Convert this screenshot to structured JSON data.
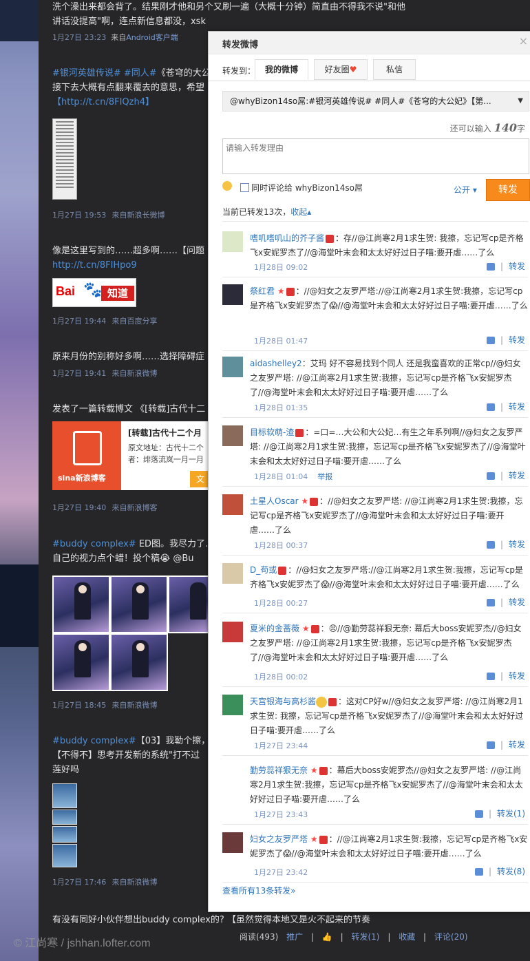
{
  "feed": {
    "post1_line1": "洗个澡出来都会背了。结果刚才他和另个又刷一遍（大概十分钟）简直由不得我不说\"和他",
    "post1_line2": "讲话没提高\"啊，连点新信息都没，xsk",
    "post1_time": "1月27日 23:23",
    "post1_from": "来自",
    "post1_src": "Android客户端",
    "post2_tag": "#银河英雄传说# #同人#",
    "post2_text": "《苍穹的大公",
    "post2_line2": "接下去大概有点翻来覆去的意思，希望",
    "post2_link": "【http://t.cn/8FIQzh4】",
    "post2_time": "1月27日 19:53",
    "post2_from": "来自",
    "post2_src": "新浪长微博",
    "post3_text": "像是这里写到的……超多啊……【问题",
    "post3_link": "http://t.cn/8FIHpo9",
    "post3_baidu_logo": "Bai",
    "post3_baidu_zd": "知道",
    "post3_time": "1月27日 19:44",
    "post3_from": "来自",
    "post3_src": "百度分享",
    "post4_text": "原来月份的别称好多啊……选择障碍症",
    "post4_time": "1月27日 19:41",
    "post4_from": "来自",
    "post4_src": "新浪微博",
    "post5_text": "发表了一篇转载博文 《[转载]古代十二",
    "post5_card_title": "[转载]古代十二个月",
    "post5_card_desc": "原文地址：古代十二个者：绯落流岚一月一月",
    "post5_card_brand": "sina新浪博客",
    "post5_card_btn": "文",
    "post5_time": "1月27日 19:40",
    "post5_from": "来自",
    "post5_src": "新浪博客",
    "post6_tag": "#buddy complex#",
    "post6_text": " ED图。我尽力了…",
    "post6_line2": "自己的视力点个蜡！投个稿😭 @Bu",
    "post6_time": "1月27日 18:45",
    "post6_from": "来自",
    "post6_src": "新浪微博",
    "post7_tag": "#buddy complex#",
    "post7_text": "【03】我勒个擦，",
    "post7_line2": "【不得不】思考开发新的系统\"打不过",
    "post7_line3": "莲好吗",
    "post7_time": "1月27日 17:46",
    "post7_from": "来自",
    "post7_src": "新浪微博",
    "post8_text": "有没有同好小伙伴想出buddy complex的? 【虽然觉得本地又是火不起来的节奏"
  },
  "bottom": {
    "watermark": "© 江尚寒 / jshhan.lofter.com",
    "read": "阅读(493)",
    "promote": "推广",
    "forward": "转发(1)",
    "collect": "收藏",
    "comment": "评论(20)",
    "sep": "|"
  },
  "dialog": {
    "title": "转发微博",
    "close": "×",
    "forward_to": "转发到：",
    "tabs": [
      "我的微博",
      "好友圈",
      "私信"
    ],
    "orig_text": "@whyBizon14so屌:#银河英雄传说# #同人#《苍穹的大公妃》【第...",
    "remain_prefix": "还可以输入",
    "remain_count": "140",
    "remain_suffix": "字",
    "reason_placeholder": "请输入转发理由",
    "also_comment": "同时评论给 whyBizon14so屌",
    "public_label": "公开 ▾",
    "send_label": "转发",
    "current_count": "当前已转发13次，",
    "collapse": "收起▴",
    "view_all": "查看所有13条转发»"
  },
  "reposts": [
    {
      "user": "嗜叽嗜叽山的芥子酱",
      "badges": "vip",
      "text": "：存//@江尚寒2月1求生贺: 我擦，忘记写cp是齐格飞x安妮罗杰了//@海堂叶末会和太太好好过日子喵:要开虐……了么",
      "time": "1月28日 09:02",
      "report": "",
      "fwd": "转发",
      "av": "#dde8c9"
    },
    {
      "user": "祭红君",
      "badges": "star vip",
      "text": "：//@妇女之友罗严塔://@江尚寒2月1求生贺:我擦，忘记写cp是齐格飞x安妮罗杰了😱//@海堂叶末会和太太好好过日子喵:要开虐……了么",
      "time": "1月28日 01:47",
      "report": "",
      "fwd": "转发",
      "av": "#2b2b3a"
    },
    {
      "user": "aidashelley2",
      "badges": "",
      "text": "：艾玛 好不容易找到个同人 还是我蛮喜欢的正常cp//@妇女之友罗严塔: //@江尚寒2月1求生贺:我擦，忘记写cp是齐格飞x安妮罗杰了//@海堂叶末会和太太好好过日子喵:要开虐……了么",
      "time": "1月28日 01:35",
      "report": "",
      "fwd": "转发",
      "av": "#5f8f9a"
    },
    {
      "user": "目标软萌-渣",
      "badges": "vip",
      "text": "：=口=…大公和大公妃…有生之年系列啊//@妇女之友罗严塔: //@江尚寒2月1求生贺:我擦，忘记写cp是齐格飞x安妮罗杰了//@海堂叶末会和太太好好过日子喵:要开虐……了么",
      "time": "1月28日 01:04",
      "report": "举报",
      "fwd": "转发",
      "av": "#8a6a5a"
    },
    {
      "user": "土星人Oscar",
      "badges": "star vip",
      "text": "：//@妇女之友罗严塔: //@江尚寒2月1求生贺:我擦，忘记写cp是齐格飞x安妮罗杰了//@海堂叶末会和太太好好过日子喵:要开虐……了么",
      "time": "1月28日 00:37",
      "report": "",
      "fwd": "转发",
      "av": "#c0503a"
    },
    {
      "user": "D_苟或",
      "badges": "vip",
      "text": "：//@妇女之友罗严塔://@江尚寒2月1求生贺:我擦，忘记写cp是齐格飞x安妮罗杰了😱//@海堂叶末会和太太好好过日子喵:要开虐……了么",
      "time": "1月28日 00:27",
      "report": "",
      "fwd": "转发",
      "av": "#d9c9a8"
    },
    {
      "user": "夏米的金蔷薇",
      "badges": "star vip",
      "text": "：😣//@勤劳蕊祥狠无奈: 幕后大boss安妮罗杰//@妇女之友罗严塔: //@江尚寒2月1求生贺:我擦，忘记写cp是齐格飞x安妮罗杰了//@海堂叶末会和太太好好过日子喵:要开虐……了么",
      "time": "1月28日 00:02",
      "report": "",
      "fwd": "转发",
      "av": "#c83a3a"
    },
    {
      "user": "天宫银海与高杉酱",
      "badges": "emo vip",
      "text": "：这对CP好w//@妇女之友罗严塔: //@江尚寒2月1求生贺: 我擦，忘记写cp是齐格飞x安妮罗杰了//@海堂叶末会和太太好好过日子喵:要开虐……了么",
      "time": "1月27日 23:44",
      "report": "",
      "fwd": "转发",
      "av": "#3a8f5a"
    },
    {
      "user": "勤劳蕊祥狠无奈",
      "badges": "star vip",
      "text": "：幕后大boss安妮罗杰//@妇女之友罗严塔: //@江尚寒2月1求生贺:我擦，忘记写cp是齐格飞x安妮罗杰了//@海堂叶末会和太太好好过日子喵:要开虐……了么",
      "time": "1月27日 23:43",
      "report": "",
      "fwd": "转发(1)",
      "av": "#ffffff"
    },
    {
      "user": "妇女之友罗严塔",
      "badges": "star vip",
      "text": "：//@江尚寒2月1求生贺:我擦，忘记写cp是齐格飞x安妮罗杰了😱//@海堂叶末会和太太好好过日子喵:要开虐……了么",
      "time": "1月27日 23:42",
      "report": "",
      "fwd": "转发(8)",
      "av": "#6a3a3a"
    }
  ],
  "colors": {
    "link": "#2f74b8",
    "send_button": "#f88a1b",
    "feed_bg": "#262628"
  }
}
